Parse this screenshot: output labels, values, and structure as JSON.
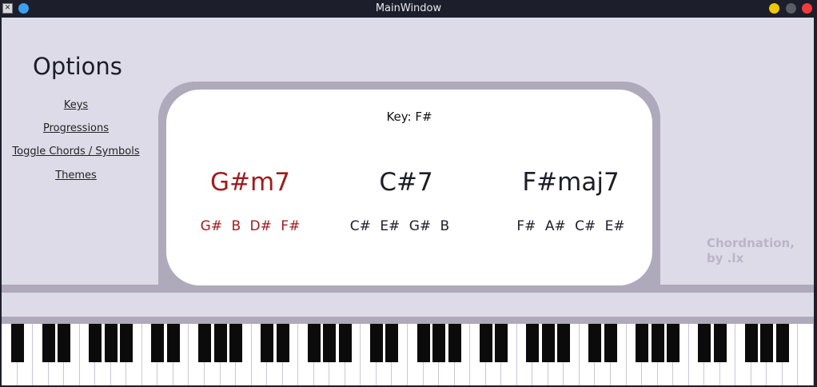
{
  "window": {
    "title": "MainWindow"
  },
  "sidebar": {
    "title": "Options",
    "links": [
      {
        "label": "Keys"
      },
      {
        "label": "Progressions"
      },
      {
        "label": "Toggle Chords / Symbols"
      },
      {
        "label": "Themes"
      }
    ]
  },
  "panel": {
    "key_label": "Key: F#",
    "chords": [
      {
        "name": "G#m7",
        "notes": "G# B D# F#",
        "highlighted": true
      },
      {
        "name": "C#7",
        "notes": "C# E# G# B",
        "highlighted": false
      },
      {
        "name": "F#maj7",
        "notes": "F# A# C# E#",
        "highlighted": false
      }
    ]
  },
  "credit": {
    "line1": "Chordnation,",
    "line2": "by .lx"
  },
  "keyboard": {
    "white_key_count": 52
  },
  "colors": {
    "background": "#dedbe9",
    "accent_red": "#9e1c1c",
    "shelf": "#aeaabb",
    "titlebar": "#1c1e2b"
  }
}
